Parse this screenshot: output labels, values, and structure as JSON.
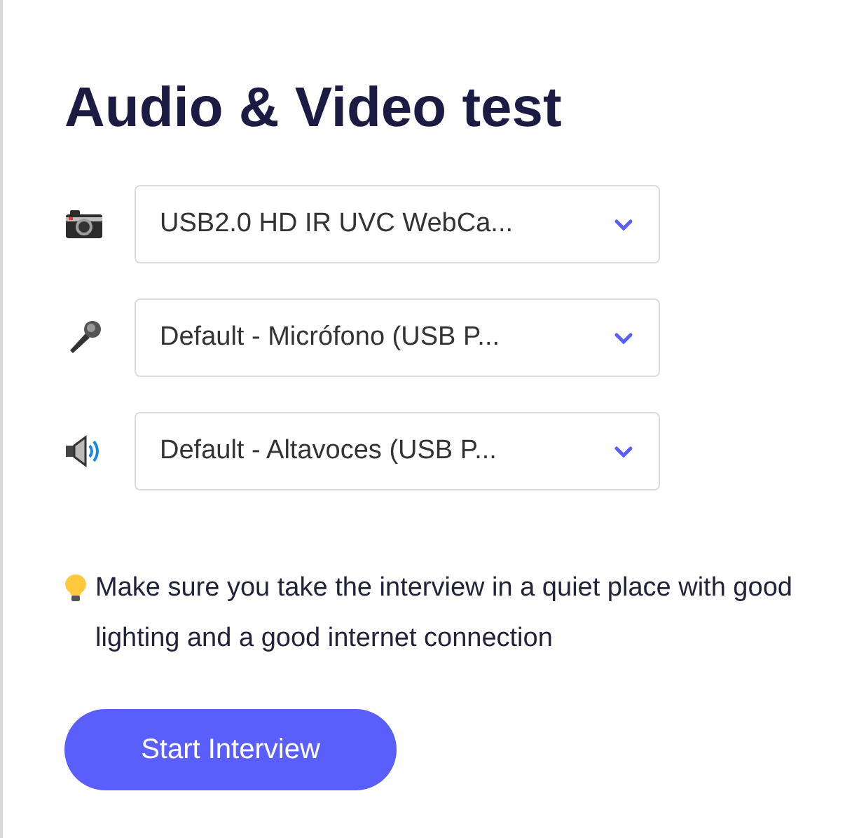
{
  "title": "Audio & Video test",
  "devices": [
    {
      "kind": "camera",
      "value": "USB2.0 HD IR UVC WebCa..."
    },
    {
      "kind": "microphone",
      "value": "Default - Micrófono (USB P..."
    },
    {
      "kind": "speaker",
      "value": "Default - Altavoces (USB P..."
    }
  ],
  "tip": "Make sure you take the interview in a quiet place with good lighting and a good internet connection",
  "button": "Start Interview"
}
